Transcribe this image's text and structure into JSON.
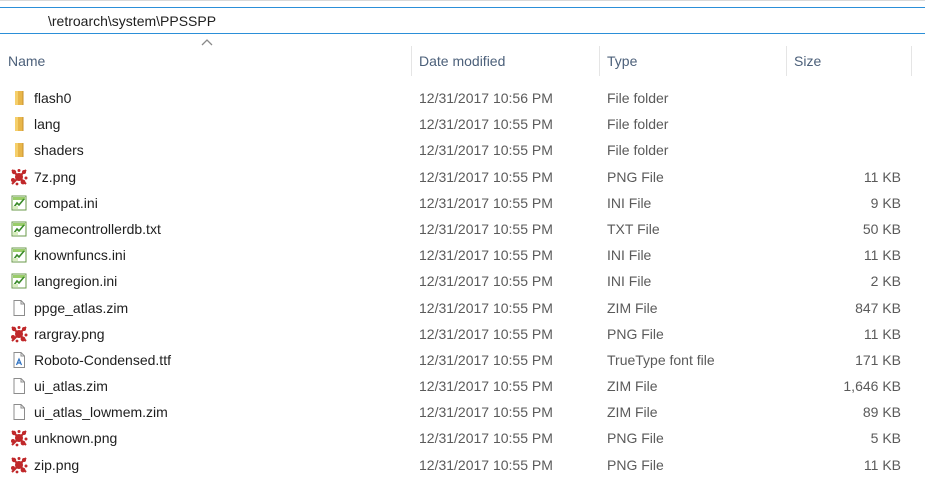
{
  "path": "\\retroarch\\system\\PPSSPP",
  "columns": {
    "name": "Name",
    "date": "Date modified",
    "type": "Type",
    "size": "Size"
  },
  "files": [
    {
      "name": "flash0",
      "date": "12/31/2017 10:56 PM",
      "type": "File folder",
      "size": "",
      "icon": "folder-icon"
    },
    {
      "name": "lang",
      "date": "12/31/2017 10:55 PM",
      "type": "File folder",
      "size": "",
      "icon": "folder-icon"
    },
    {
      "name": "shaders",
      "date": "12/31/2017 10:55 PM",
      "type": "File folder",
      "size": "",
      "icon": "folder-icon"
    },
    {
      "name": "7z.png",
      "date": "12/31/2017 10:55 PM",
      "type": "PNG File",
      "size": "11 KB",
      "icon": "png-icon"
    },
    {
      "name": "compat.ini",
      "date": "12/31/2017 10:55 PM",
      "type": "INI File",
      "size": "9 KB",
      "icon": "ini-icon"
    },
    {
      "name": "gamecontrollerdb.txt",
      "date": "12/31/2017 10:55 PM",
      "type": "TXT File",
      "size": "50 KB",
      "icon": "txt-icon"
    },
    {
      "name": "knownfuncs.ini",
      "date": "12/31/2017 10:55 PM",
      "type": "INI File",
      "size": "11 KB",
      "icon": "ini-icon"
    },
    {
      "name": "langregion.ini",
      "date": "12/31/2017 10:55 PM",
      "type": "INI File",
      "size": "2 KB",
      "icon": "ini-icon"
    },
    {
      "name": "ppge_atlas.zim",
      "date": "12/31/2017 10:55 PM",
      "type": "ZIM File",
      "size": "847 KB",
      "icon": "blank-file-icon"
    },
    {
      "name": "rargray.png",
      "date": "12/31/2017 10:55 PM",
      "type": "PNG File",
      "size": "11 KB",
      "icon": "png-icon"
    },
    {
      "name": "Roboto-Condensed.ttf",
      "date": "12/31/2017 10:55 PM",
      "type": "TrueType font file",
      "size": "171 KB",
      "icon": "font-file-icon"
    },
    {
      "name": "ui_atlas.zim",
      "date": "12/31/2017 10:55 PM",
      "type": "ZIM File",
      "size": "1,646 KB",
      "icon": "blank-file-icon"
    },
    {
      "name": "ui_atlas_lowmem.zim",
      "date": "12/31/2017 10:55 PM",
      "type": "ZIM File",
      "size": "89 KB",
      "icon": "blank-file-icon"
    },
    {
      "name": "unknown.png",
      "date": "12/31/2017 10:55 PM",
      "type": "PNG File",
      "size": "5 KB",
      "icon": "png-icon"
    },
    {
      "name": "zip.png",
      "date": "12/31/2017 10:55 PM",
      "type": "PNG File",
      "size": "11 KB",
      "icon": "png-icon"
    }
  ],
  "colors": {
    "accent": "#2b8fd8",
    "header_text": "#4c607a",
    "folder": "#e8b64a",
    "png_red": "#c0282a"
  }
}
